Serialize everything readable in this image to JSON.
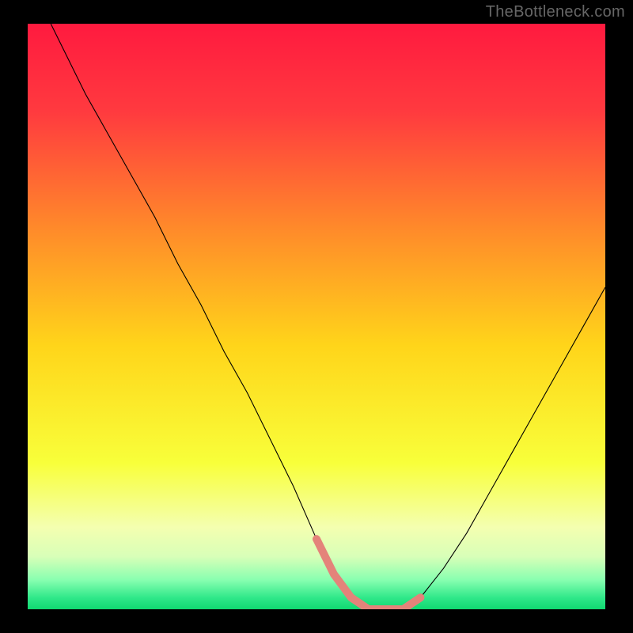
{
  "watermark": "TheBottleneck.com",
  "chart_data": {
    "type": "line",
    "title": "",
    "xlabel": "",
    "ylabel": "",
    "xlim": [
      0,
      100
    ],
    "ylim": [
      0,
      100
    ],
    "background_gradient": {
      "stops": [
        {
          "offset": 0,
          "color": "#ff1a3f"
        },
        {
          "offset": 15,
          "color": "#ff3a3f"
        },
        {
          "offset": 35,
          "color": "#ff8a2a"
        },
        {
          "offset": 55,
          "color": "#ffd51a"
        },
        {
          "offset": 75,
          "color": "#f8ff3a"
        },
        {
          "offset": 86,
          "color": "#f4ffb0"
        },
        {
          "offset": 91,
          "color": "#d8ffb8"
        },
        {
          "offset": 95,
          "color": "#88ffb0"
        },
        {
          "offset": 98,
          "color": "#30e88a"
        },
        {
          "offset": 100,
          "color": "#10d870"
        }
      ]
    },
    "series": [
      {
        "name": "bottleneck-curve",
        "color": "#000000",
        "stroke_width": 1.1,
        "x": [
          4,
          7,
          10,
          14,
          18,
          22,
          26,
          30,
          34,
          38,
          42,
          46,
          50,
          53,
          56,
          59,
          62,
          65,
          68,
          72,
          76,
          80,
          84,
          88,
          92,
          96,
          100
        ],
        "y": [
          100,
          94,
          88,
          81,
          74,
          67,
          59,
          52,
          44,
          37,
          29,
          21,
          12,
          6,
          2,
          0,
          0,
          0,
          2,
          7,
          13,
          20,
          27,
          34,
          41,
          48,
          55
        ]
      },
      {
        "name": "highlight-band",
        "color": "#e4837a",
        "stroke_width": 10,
        "linecap": "round",
        "x": [
          50,
          53,
          56,
          59,
          62,
          65,
          68
        ],
        "y": [
          12,
          6,
          2,
          0,
          0,
          0,
          2
        ]
      }
    ],
    "annotations": []
  }
}
